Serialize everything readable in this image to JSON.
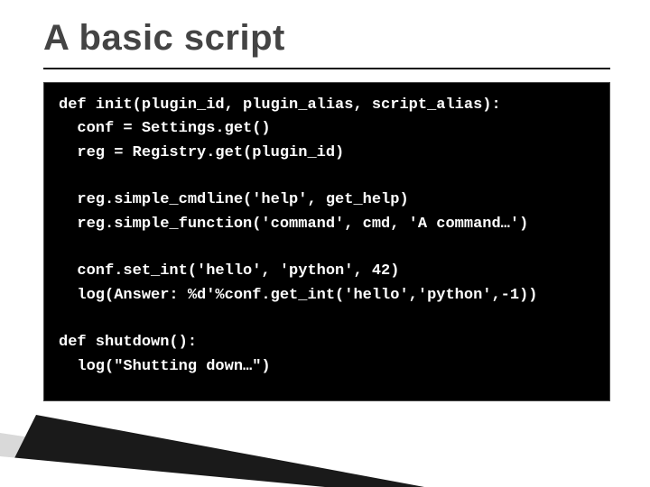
{
  "title": "A basic script",
  "code_lines": [
    "def init(plugin_id, plugin_alias, script_alias):",
    "  conf = Settings.get()",
    "  reg = Registry.get(plugin_id)",
    "",
    "  reg.simple_cmdline('help', get_help)",
    "  reg.simple_function('command', cmd, 'A command…')",
    "",
    "  conf.set_int('hello', 'python', 42)",
    "  log(Answer: %d'%conf.get_int('hello','python',-1))",
    "",
    "def shutdown():",
    "  log(\"Shutting down…\")"
  ]
}
